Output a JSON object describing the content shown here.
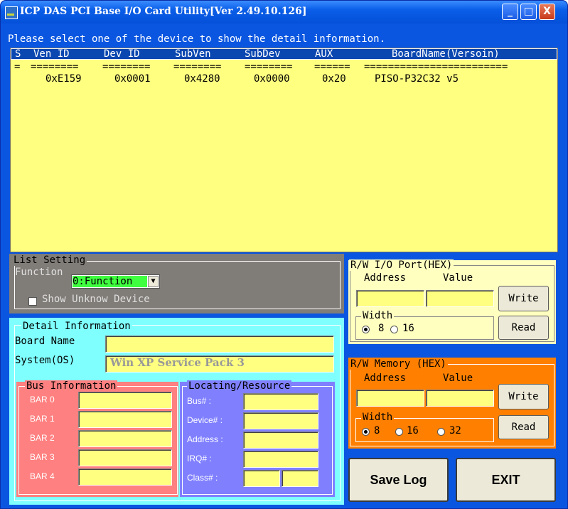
{
  "window": {
    "title": "ICP DAS PCI Base I/O Card Utility[Ver 2.49.10.126]",
    "btn_minimize": "_",
    "btn_maximize": "□",
    "btn_close": "X"
  },
  "hint": "Please select one of the device to show the detail information.",
  "device_list": {
    "columns": [
      "S",
      "Ven ID",
      "Dev ID",
      "SubVen",
      "SubDev",
      "AUX",
      "BoardName(Versoin)"
    ],
    "separators": [
      "=",
      "========",
      "========",
      "========",
      "========",
      "======",
      "========================"
    ],
    "rows": [
      {
        "s": "",
        "ven": "0xE159",
        "dev": "0x0001",
        "subven": "0x4280",
        "subdev": "0x0000",
        "aux": "0x20",
        "board": "PISO-P32C32 v5"
      }
    ]
  },
  "list_setting": {
    "title": "List Setting",
    "function_label": "Function",
    "function_value": "0:Function",
    "show_unknown_label": "Show Unknow Device"
  },
  "detail": {
    "title": "Detail Information",
    "board_name_label": "Board Name",
    "board_name_value": "",
    "system_label": "System(OS)",
    "system_value": "Win XP Service Pack 3"
  },
  "bus_info": {
    "title": "Bus Information",
    "bars": [
      "BAR 0",
      "BAR 1",
      "BAR 2",
      "BAR 3",
      "BAR 4"
    ]
  },
  "locating": {
    "title": "Locating/Resource",
    "labels": [
      "Bus# :",
      "Device# :",
      "Address :",
      "IRQ# :",
      "Class# :"
    ]
  },
  "rw_io": {
    "title": "R/W I/O Port(HEX)",
    "address_label": "Address",
    "value_label": "Value",
    "width_label": "Width",
    "width_options": [
      "8",
      "16"
    ],
    "width_selected": "8",
    "write_label": "Write",
    "read_label": "Read"
  },
  "rw_mem": {
    "title": "R/W Memory (HEX)",
    "address_label": "Address",
    "value_label": "Value",
    "width_label": "Width",
    "width_options": [
      "8",
      "16",
      "32"
    ],
    "width_selected": "8",
    "write_label": "Write",
    "read_label": "Read"
  },
  "actions": {
    "save_log": "Save Log",
    "exit": "EXIT"
  },
  "colors": {
    "list_bg": "#ffff80",
    "list_setting_bg": "#807c78",
    "detail_bg": "#80ffff",
    "bus_bg": "#ff8080",
    "locating_bg": "#8080ff",
    "memory_bg": "#ff8000",
    "window_blue": "#0a56e0"
  }
}
